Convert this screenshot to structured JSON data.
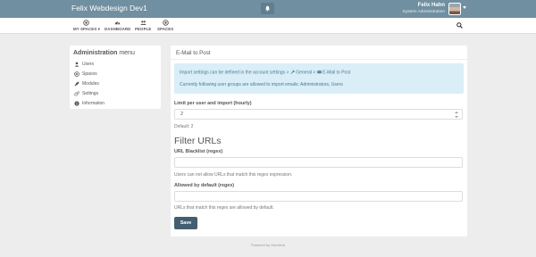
{
  "topbar": {
    "brand": "Felix Webdesign Dev1",
    "user_name": "Felix Hahn",
    "user_role": "System Administration",
    "bg_color": "#708fa0"
  },
  "nav": {
    "items": [
      {
        "label": "MY SPACES ▾",
        "icon": "dot-circle-icon"
      },
      {
        "label": "DASHBOARD",
        "icon": "tachometer-icon"
      },
      {
        "label": "PEOPLE",
        "icon": "users-icon"
      },
      {
        "label": "SPACES",
        "icon": "dot-circle-icon"
      }
    ]
  },
  "sidebar": {
    "title_bold": "Administration",
    "title_rest": " menu",
    "items": [
      {
        "label": "Users",
        "icon": "user-icon"
      },
      {
        "label": "Spaces",
        "icon": "inbox-icon"
      },
      {
        "label": "Modules",
        "icon": "rocket-icon"
      },
      {
        "label": "Settings",
        "icon": "cogs-icon"
      },
      {
        "label": "Information",
        "icon": "info-circle-icon"
      }
    ]
  },
  "panel": {
    "title": "E-Mail to Post",
    "info_line1_pre": "Import settings can be defined in the account settings >",
    "info_line1_general": "General",
    "info_line1_sep": ">",
    "info_line1_email": "E-Mail to Post",
    "info_line2": "Currently following user groups are allowed to import emails: Administrators, Users",
    "info_bg": "#d9eef7",
    "limit_label": "Limit per user and import (hourly)",
    "limit_value": "2",
    "limit_default": "Default: 2",
    "filter_heading": "Filter URLs",
    "blacklist_label": "URL Blacklist (regex)",
    "blacklist_value": "",
    "blacklist_help": "Users can not allow URLs that match this regex expression.",
    "allowed_label": "Allowed by default (regex)",
    "allowed_value": "",
    "allowed_help": "URLs that match this regex are allowed by default.",
    "save_label": "Save",
    "save_color": "#435f6f"
  },
  "footer": {
    "text": "Powered by HumHub"
  }
}
